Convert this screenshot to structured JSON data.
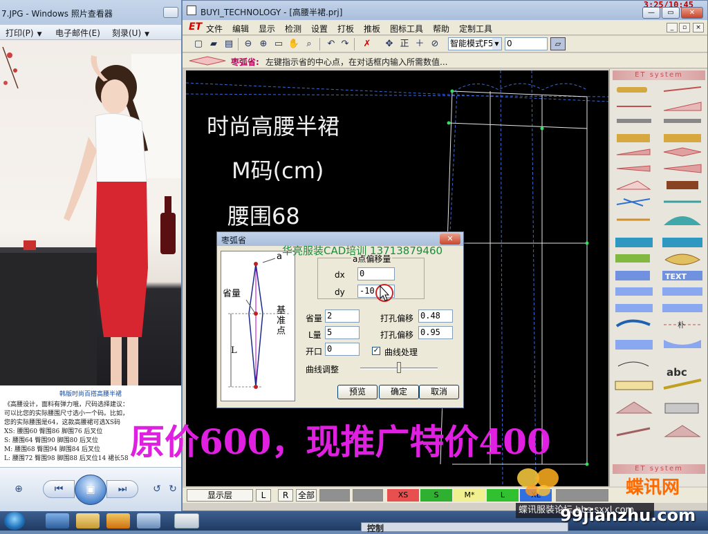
{
  "photo_viewer": {
    "title": "7.JPG - Windows 照片查看器",
    "menu": [
      {
        "label": "打印(P)"
      },
      {
        "label": "电子邮件(E)"
      },
      {
        "label": "刻录(U)"
      }
    ],
    "caption": {
      "title": "韩版时尚百搭高腰半裙",
      "lines": [
        "《高腰设计，面料有弹力哦，尺码选择建议：",
        "可以比您的实际腰围尺寸选小一个码。比如，",
        "您的实际腰围是64，这款高腰裙可选XS码",
        "XS: 腰围60    臀围86    脚围76    后叉位",
        "S:  腰围64    臀围90    脚围80    后叉位",
        "M:  腰围68    臀围94    脚围84    后叉位",
        "L:  腰围72    臀围98    脚围88    后叉位14   裙长58"
      ]
    }
  },
  "cad": {
    "title": "BUYI_TECHNOLOGY - [高腰半裙.prj]",
    "clock": "3:25/10:45",
    "logo": "ET",
    "menu": [
      "文件",
      "编辑",
      "显示",
      "检测",
      "设置",
      "打板",
      "推板",
      "图标工具",
      "帮助",
      "定制工具"
    ],
    "toolbar": {
      "mode": "智能模式F5",
      "value": "0",
      "icons": [
        "new-icon",
        "open-icon",
        "save-icon",
        "zoom-out-icon",
        "zoom-in-icon",
        "fit-icon",
        "pan-icon",
        "zoom-window-icon",
        "undo-icon",
        "redo-icon",
        "select-delete-icon",
        "move-icon",
        "ortho-icon",
        "crosshair-icon",
        "no-snap-icon"
      ],
      "ortho_label": "正"
    },
    "status": {
      "label": "枣弧省:",
      "text": "左键指示省的中心点，在对话框内输入所需数值..."
    },
    "canvas": {
      "lines": [
        "时尚高腰半裙",
        "M码(cm)",
        "腰围68"
      ]
    },
    "side_panel": {
      "header": "ET system",
      "footer": "ET system",
      "tool_text": [
        "abc",
        "TEXT",
        "朴"
      ]
    },
    "bottom": {
      "display_layer": "显示层",
      "left": "L",
      "right": "R",
      "all": "全部",
      "sizes": [
        {
          "label": "XS",
          "color": "#e85050"
        },
        {
          "label": "S",
          "color": "#30b030"
        },
        {
          "label": "M*",
          "color": "#f0f090"
        },
        {
          "label": "L",
          "color": "#30c030"
        },
        {
          "label": "XL",
          "color": "#3070e0"
        }
      ]
    }
  },
  "dialog": {
    "title": "枣弧省",
    "diagram_labels": {
      "a": "a",
      "dart_amount": "省量",
      "base": "基准点",
      "length": "L"
    },
    "offset_group": "a点偏移量",
    "dx_label": "dx",
    "dx_value": "0",
    "dy_label": "dy",
    "dy_value": "-10",
    "dart_label": "省量",
    "dart_value": "2",
    "l_label": "L量",
    "l_value": "5",
    "open_label": "开口",
    "open_value": "0",
    "punch1_label": "打孔偏移",
    "punch1_value": "0.48",
    "punch2_label": "打孔偏移",
    "punch2_value": "0.95",
    "curve_process": "曲线处理",
    "curve_adjust": "曲线调整",
    "preview": "预览",
    "ok": "确定",
    "cancel": "取消",
    "curve_checked": true,
    "curve_adjust_level": 0.5
  },
  "overlays": {
    "watermark": "华亮服装CAD培训 13713879460",
    "promo": "原价600，现推广特价400",
    "brand": "蝶讯网",
    "site": "99jianzhu.com",
    "tooltip": "蝶讯服装论坛 bbs.sxxl.com"
  },
  "taskbar": {
    "popup": "控制"
  }
}
